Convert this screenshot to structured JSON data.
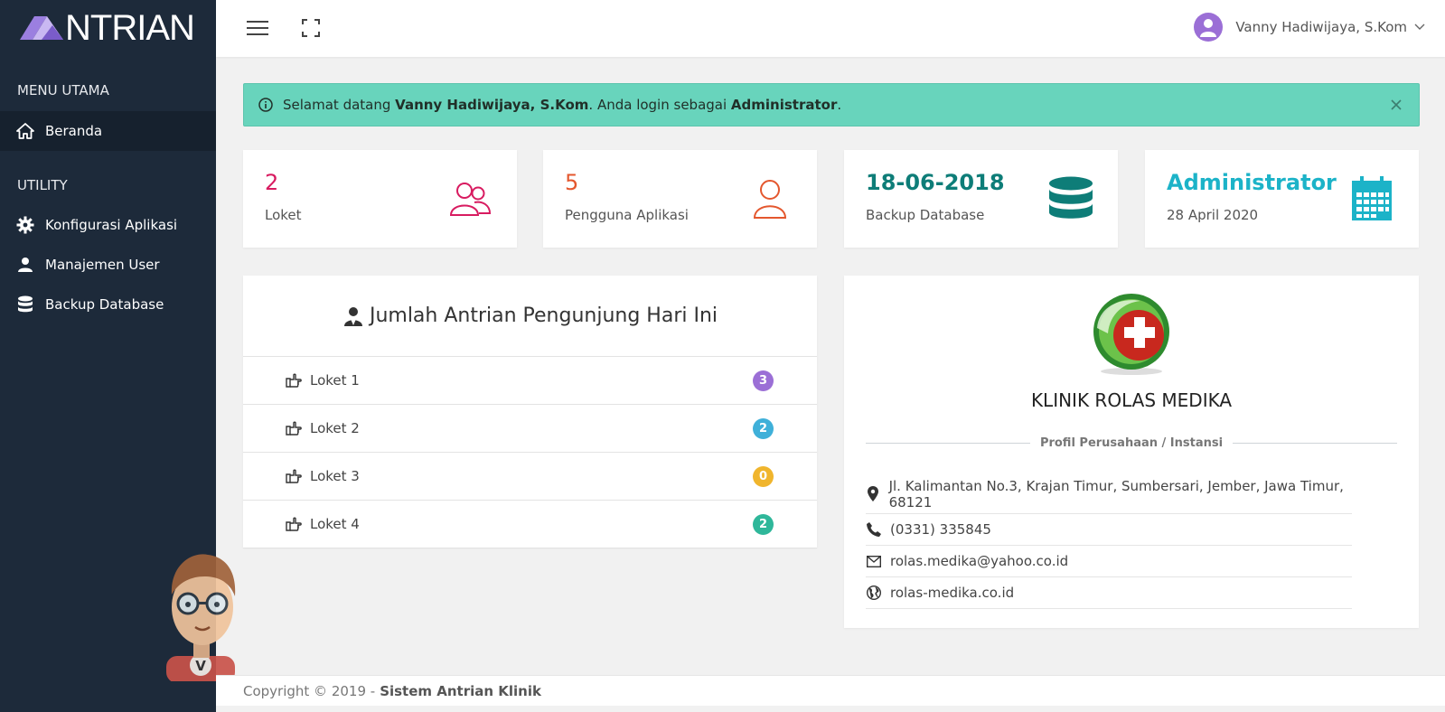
{
  "app": {
    "logo_text": "NTRIAN"
  },
  "sidebar": {
    "header_main": "MENU UTAMA",
    "header_utility": "UTILITY",
    "items": [
      {
        "label": "Beranda",
        "icon": "home-icon",
        "active": true
      },
      {
        "label": "Konfigurasi Aplikasi",
        "icon": "gear-icon"
      },
      {
        "label": "Manajemen User",
        "icon": "user-icon"
      },
      {
        "label": "Backup Database",
        "icon": "database-icon"
      }
    ]
  },
  "topbar": {
    "user_name": "Vanny Hadiwijaya, S.Kom"
  },
  "alert": {
    "prefix": "Selamat datang ",
    "user": "Vanny Hadiwijaya, S.Kom",
    "middle": ". Anda login sebagai ",
    "role": "Administrator",
    "suffix": "."
  },
  "stats": [
    {
      "value": "2",
      "label": "Loket",
      "icon": "users-icon",
      "color": "#d81b60"
    },
    {
      "value": "5",
      "label": "Pengguna Aplikasi",
      "icon": "user-outline-icon",
      "color": "#e4572e"
    },
    {
      "value": "18-06-2018",
      "label": "Backup Database",
      "icon": "database-icon",
      "color": "#0e7d78"
    },
    {
      "value": "Administrator",
      "label": "28 April 2020",
      "icon": "calendar-icon",
      "color": "#1cb3c8"
    }
  ],
  "queue": {
    "title": "Jumlah Antrian Pengunjung Hari Ini",
    "rows": [
      {
        "label": "Loket 1",
        "count": "3",
        "color": "#9b6fd6"
      },
      {
        "label": "Loket 2",
        "count": "2",
        "color": "#3fb0d9"
      },
      {
        "label": "Loket 3",
        "count": "0",
        "color": "#f0b52d"
      },
      {
        "label": "Loket 4",
        "count": "2",
        "color": "#2fb79a"
      }
    ]
  },
  "profile": {
    "name": "KLINIK ROLAS MEDIKA",
    "section_title": "Profil Perusahaan / Instansi",
    "address": "Jl. Kalimantan No.3, Krajan Timur, Sumbersari, Jember, Jawa Timur, 68121",
    "phone": "(0331) 335845",
    "email": "rolas.medika@yahoo.co.id",
    "website": "rolas-medika.co.id"
  },
  "footer": {
    "copyright": "Copyright © 2019 -",
    "app_name": "Sistem Antrian Klinik"
  }
}
